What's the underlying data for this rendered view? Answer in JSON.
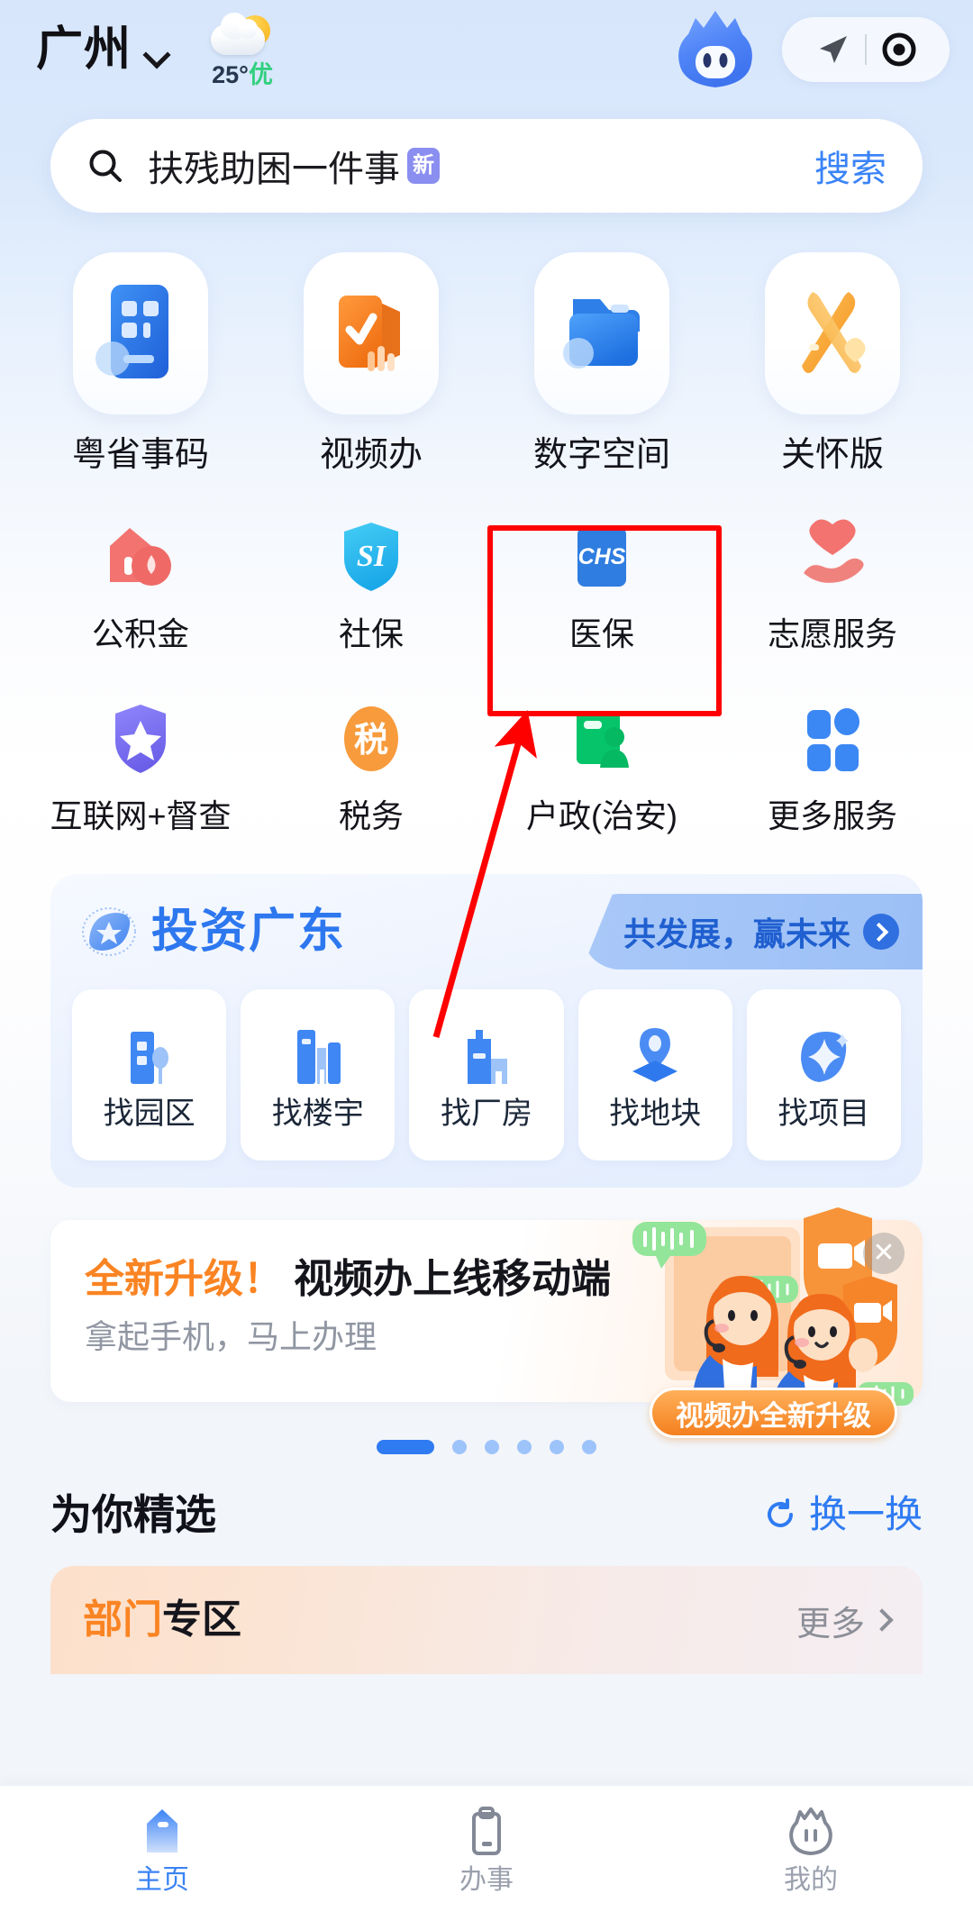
{
  "header": {
    "city": "广州",
    "city_chevron_icon": "chevron-down-icon",
    "weather": {
      "icon": "sun-behind-cloud-icon",
      "temperature": "25°",
      "air_quality": "优"
    },
    "mascot_icon": "mascot-avatar-icon",
    "location_icon": "navigation-arrow-icon",
    "scan_icon": "target-dot-icon"
  },
  "search": {
    "icon": "search-icon",
    "keyword": "扶残助困一件事",
    "badge": "新",
    "button": "搜索"
  },
  "quick_grid": {
    "row1": [
      {
        "label": "粤省事码",
        "icon": "qr-card-icon"
      },
      {
        "label": "视频办",
        "icon": "video-check-icon"
      },
      {
        "label": "数字空间",
        "icon": "blue-folder-icon"
      },
      {
        "label": "关怀版",
        "icon": "ribbon-heart-icon"
      }
    ],
    "row2": [
      {
        "label": "公积金",
        "icon": "house-fund-icon"
      },
      {
        "label": "社保",
        "icon": "si-shield-icon"
      },
      {
        "label": "医保",
        "icon": "chs-card-icon"
      },
      {
        "label": "志愿服务",
        "icon": "heart-hand-icon"
      }
    ],
    "row3": [
      {
        "label": "互联网+督查",
        "icon": "star-shield-icon"
      },
      {
        "label": "税务",
        "icon": "tax-circle-icon"
      },
      {
        "label": "户政(治安)",
        "icon": "id-card-person-icon"
      },
      {
        "label": "更多服务",
        "icon": "grid-more-icon"
      }
    ]
  },
  "annotation": {
    "highlight_target": "医保",
    "highlight_color": "#ff0000",
    "arrow_color": "#ff0000"
  },
  "invest": {
    "logo_icon": "invest-globe-icon",
    "title": "投资广东",
    "tag_text": "共发展，赢未来",
    "tag_arrow_icon": "chevron-right-circle-icon",
    "items": [
      {
        "label": "找园区",
        "icon": "park-building-icon"
      },
      {
        "label": "找楼宇",
        "icon": "tower-building-icon"
      },
      {
        "label": "找厂房",
        "icon": "factory-icon"
      },
      {
        "label": "找地块",
        "icon": "land-pin-icon"
      },
      {
        "label": "找项目",
        "icon": "project-spark-icon"
      }
    ]
  },
  "video_banner": {
    "title_highlight": "全新升级！",
    "title_main": "视频办上线移动端",
    "subtitle": "拿起手机，马上办理",
    "badge": "视频办全新升级",
    "close_icon": "close-icon",
    "art_icon": "service-agents-illustration"
  },
  "carousel": {
    "total": 6,
    "active_index": 0
  },
  "for_you": {
    "title": "为你精选",
    "refresh_icon": "refresh-icon",
    "refresh_label": "换一换"
  },
  "dept_card": {
    "title_orange": "部门",
    "title_dark": "专区",
    "more_label": "更多",
    "more_icon": "chevron-right-icon"
  },
  "tabbar": [
    {
      "label": "主页",
      "icon": "home-icon",
      "active": true
    },
    {
      "label": "办事",
      "icon": "clipboard-icon",
      "active": false
    },
    {
      "label": "我的",
      "icon": "profile-mascot-icon",
      "active": false
    }
  ]
}
